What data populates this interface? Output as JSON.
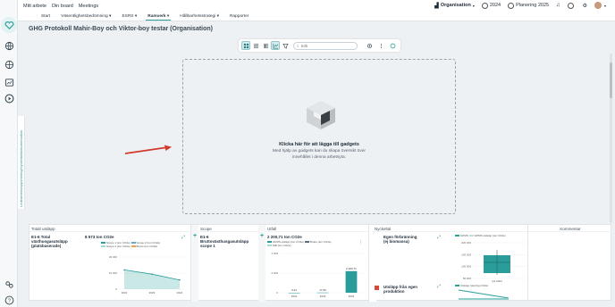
{
  "topbar": {
    "nav": [
      "Mitt arbete",
      "Din board",
      "Meetings"
    ],
    "organisation": "Organisation",
    "year": "2024",
    "planning": "Planering 2025"
  },
  "tabs": [
    "Start",
    "Väsentlighetsbedömning",
    "ESRS",
    "Ramverk",
    "Hållbarhetsstrategi",
    "Rapporter"
  ],
  "active_tab": "Ramverk",
  "page_title": "GHG Protokoll Mahir-Boy och Viktor-boy testar (Organisation)",
  "toolbar": {
    "search_placeholder": "Sök"
  },
  "dropzone": {
    "title": "Klicka här för att lägga till gadgets",
    "subtitle": "Med hjälp av gadgets kan du skapa översikt över innehållet i denna arbetsyta."
  },
  "side_tab_label": "Ledbarhetsrapportering/Nyckeltal/dokumentation",
  "columns": {
    "c1": "Totalt utsläpp",
    "c2": "Scope",
    "c3": "Utfall",
    "c4": "Nyckeltal",
    "c5": "Kommentar"
  },
  "cards": {
    "card1": {
      "title": "E1-6 Total växthusgasutsläpp (platsbaserade)",
      "value": "8 573 ton CO2e"
    },
    "card2": {
      "title": "E1-6 Bruttoväxthusgasutsläpp scope 1"
    },
    "card3": {
      "value": "2 200,71 ton CO2e"
    },
    "card4": {
      "title": "Egen förbränning (ej biomassa)"
    },
    "card5": {
      "title": "Utsläpp från egen produktion"
    }
  },
  "legends": {
    "l1": [
      "Scope 1 (ton CO2e)",
      "Scope 2 (ton CO2e)",
      "Scope 3 (ton CO2e)",
      "Brutto (ton CO2e)"
    ],
    "l3": [
      "GPMS utsläpp (ton CO2e)",
      "Brutto (ton CO2e)",
      "Mål (ton CO2e)"
    ],
    "l4": [
      "GPMS",
      "GPMS utsläpp (ton CO2e)"
    ],
    "l5": [
      "Utsläpp total (kg CO2e)"
    ]
  },
  "chart_data": [
    {
      "type": "line",
      "x": [
        "2022",
        "2023",
        "2024"
      ],
      "series": [
        {
          "name": "Brutto (ton CO2e)",
          "values": [
            18000,
            14000,
            8573
          ]
        }
      ],
      "ylim": [
        0,
        30000
      ],
      "yticks": [
        "30 000",
        "15 000",
        "0"
      ]
    },
    {
      "type": "bar",
      "categories": [
        "2022",
        "2023",
        "2024"
      ],
      "values": [
        0.21,
        17.06,
        2200.71
      ],
      "labels": [
        "0,21",
        "17,06",
        "2 200,71"
      ],
      "ylim": [
        0,
        4000
      ],
      "yticks": [
        "4 000",
        "2 000",
        "0"
      ]
    },
    {
      "type": "bar",
      "categories": [
        "Q1 2024"
      ],
      "values": [
        100
      ],
      "yticks": [
        "200 000",
        "150 000",
        "100 000",
        "50 000"
      ]
    }
  ]
}
